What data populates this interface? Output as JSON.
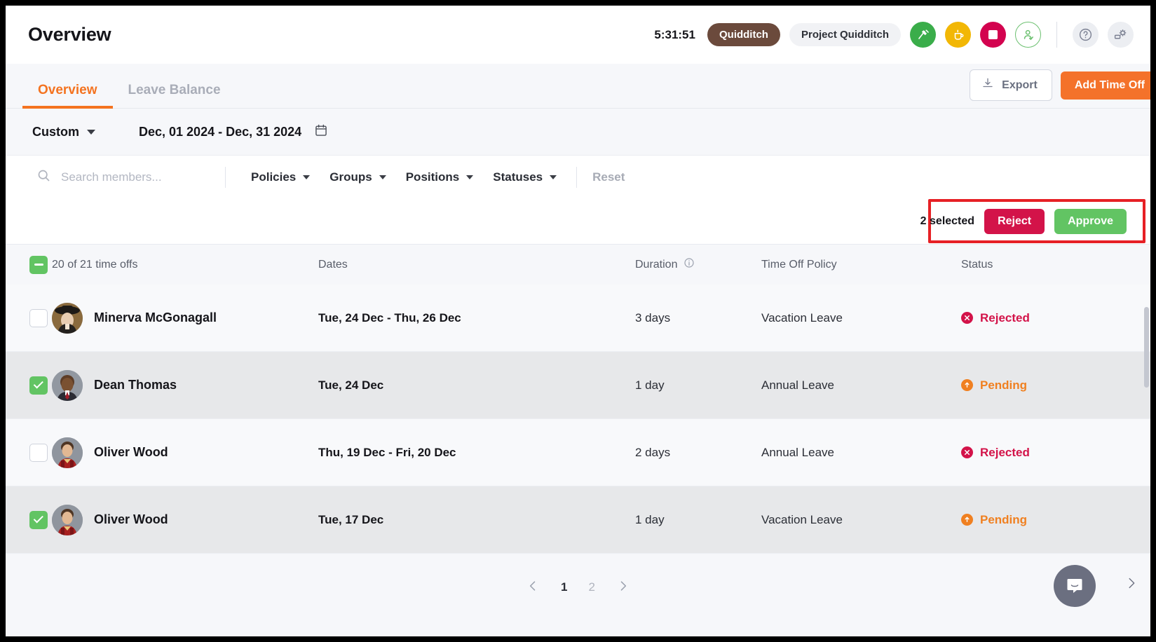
{
  "header": {
    "title": "Overview",
    "timer": "5:31:51",
    "task_pill": "Quidditch",
    "project_pill": "Project Quidditch",
    "icons": {
      "activity": "activity-icon",
      "break": "coffee-break-icon",
      "stop": "stop-icon",
      "person_check": "person-check-icon",
      "help": "help-icon",
      "settings": "settings-icon"
    }
  },
  "tabs": [
    {
      "label": "Overview",
      "active": true
    },
    {
      "label": "Leave Balance",
      "active": false
    }
  ],
  "actions": {
    "export_label": "Export",
    "add_time_off_label": "Add Time Off"
  },
  "daterow": {
    "preset": "Custom",
    "range": "Dec, 01 2024 - Dec, 31 2024"
  },
  "filters": {
    "search_placeholder": "Search members...",
    "search_value": "",
    "items": [
      {
        "label": "Policies"
      },
      {
        "label": "Groups"
      },
      {
        "label": "Positions"
      },
      {
        "label": "Statuses"
      }
    ],
    "reset_label": "Reset"
  },
  "selection": {
    "count_label": "2 selected",
    "reject_label": "Reject",
    "approve_label": "Approve",
    "highlight_color": "#e62025"
  },
  "table": {
    "headers": {
      "count": "20 of 21 time offs",
      "dates": "Dates",
      "duration": "Duration",
      "policy": "Time Off Policy",
      "status": "Status"
    },
    "rows": [
      {
        "name": "Minerva McGonagall",
        "dates": "Tue, 24 Dec - Thu, 26 Dec",
        "duration": "3 days",
        "policy": "Vacation Leave",
        "status": "Rejected",
        "status_kind": "rejected",
        "checked": false
      },
      {
        "name": "Dean Thomas",
        "dates": "Tue, 24 Dec",
        "duration": "1 day",
        "policy": "Annual Leave",
        "status": "Pending",
        "status_kind": "pending",
        "checked": true
      },
      {
        "name": "Oliver Wood",
        "dates": "Thu, 19 Dec - Fri, 20 Dec",
        "duration": "2 days",
        "policy": "Annual Leave",
        "status": "Rejected",
        "status_kind": "rejected",
        "checked": false
      },
      {
        "name": "Oliver Wood",
        "dates": "Tue, 17 Dec",
        "duration": "1 day",
        "policy": "Vacation Leave",
        "status": "Pending",
        "status_kind": "pending",
        "checked": true
      }
    ]
  },
  "pagination": {
    "prev": "‹",
    "pages": [
      {
        "label": "1",
        "active": true
      },
      {
        "label": "2",
        "active": false
      }
    ],
    "next": "›"
  },
  "colors": {
    "accent": "#f47320",
    "approve": "#62c463",
    "reject": "#d31349",
    "pending": "#f08021"
  }
}
